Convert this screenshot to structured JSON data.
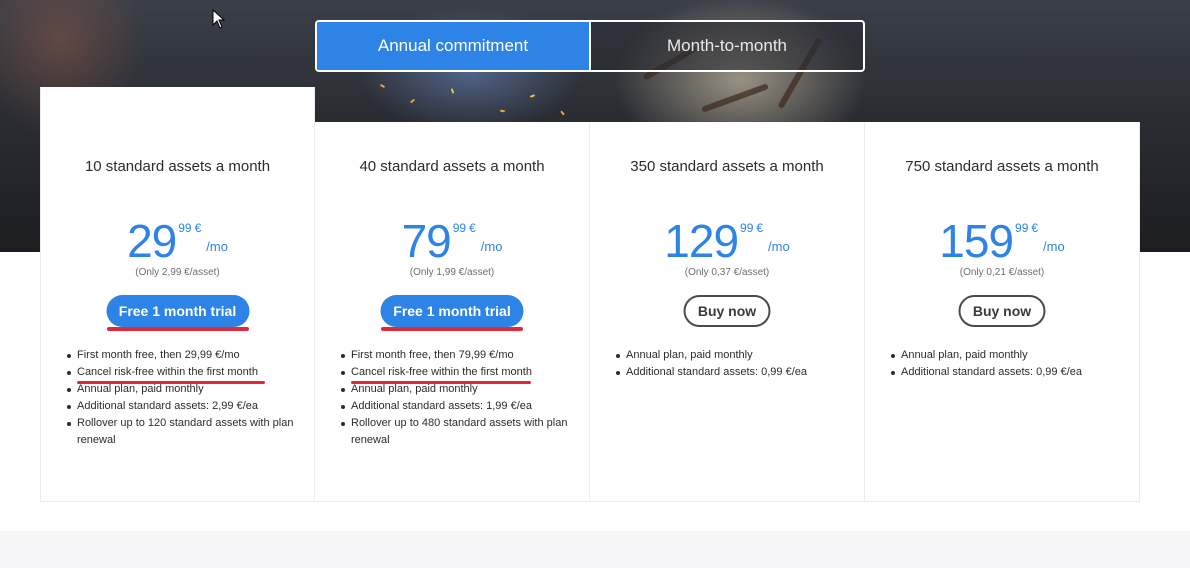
{
  "billing_toggle": {
    "annual_label": "Annual commitment",
    "monthly_label": "Month-to-month",
    "selected": "Annual commitment"
  },
  "plans": [
    {
      "title": "10 standard assets a month",
      "price_main": "29",
      "price_decimal": "99",
      "currency": "€",
      "period": "/mo",
      "per_asset": "(Only 2,99 €/asset)",
      "cta": "Free 1 month trial",
      "cta_style": "primary",
      "features": [
        "First month free, then 29,99 €/mo",
        "Cancel risk-free within the first month",
        "Annual plan, paid monthly",
        "Additional standard assets: 2,99 €/ea",
        "Rollover up to 120 standard assets with plan renewal"
      ]
    },
    {
      "title": "40 standard assets a month",
      "price_main": "79",
      "price_decimal": "99",
      "currency": "€",
      "period": "/mo",
      "per_asset": "(Only 1,99 €/asset)",
      "cta": "Free 1 month trial",
      "cta_style": "primary",
      "features": [
        "First month free, then 79,99 €/mo",
        "Cancel risk-free within the first month",
        "Annual plan, paid monthly",
        "Additional standard assets: 1,99 €/ea",
        "Rollover up to 480 standard assets with plan renewal"
      ]
    },
    {
      "title": "350 standard assets a month",
      "price_main": "129",
      "price_decimal": "99",
      "currency": "€",
      "period": "/mo",
      "per_asset": "(Only 0,37 €/asset)",
      "cta": "Buy now",
      "cta_style": "outline",
      "features": [
        "Annual plan, paid monthly",
        "Additional standard assets: 0,99 €/ea"
      ]
    },
    {
      "title": "750 standard assets a month",
      "price_main": "159",
      "price_decimal": "99",
      "currency": "€",
      "period": "/mo",
      "per_asset": "(Only 0,21 €/asset)",
      "cta": "Buy now",
      "cta_style": "outline",
      "features": [
        "Annual plan, paid monthly",
        "Additional standard assets: 0,99 €/ea"
      ]
    }
  ],
  "colors": {
    "accent": "#2d84e6",
    "annotation": "#e0293b",
    "text": "#2c2c2c"
  },
  "icons": [
    "mouse-pointer-icon"
  ]
}
